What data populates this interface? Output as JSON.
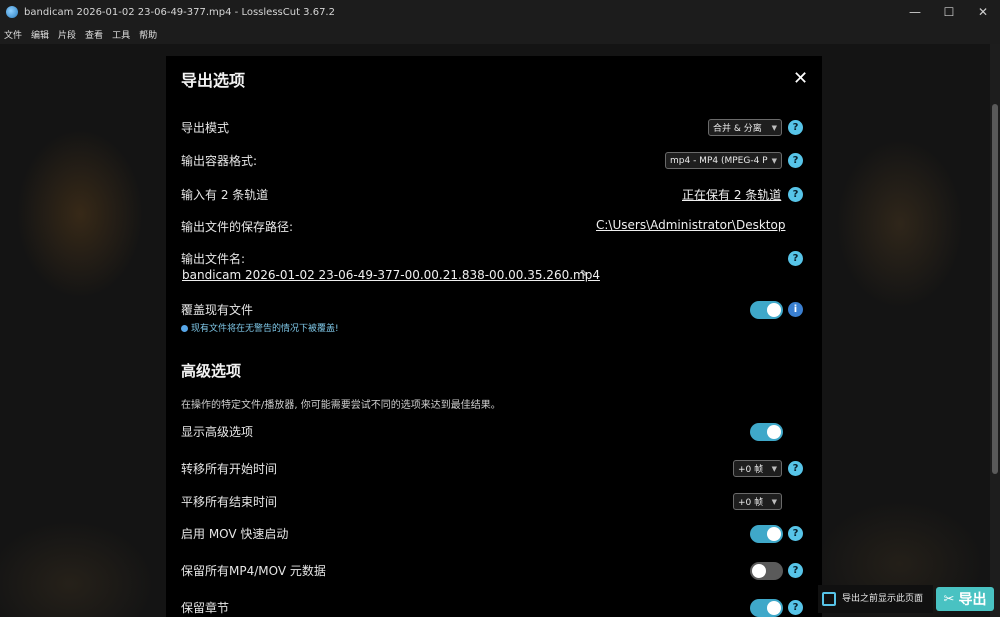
{
  "window": {
    "title": "bandicam 2026-01-02 23-06-49-377.mp4 - LosslessCut 3.67.2",
    "minimize": "—",
    "maximize": "☐",
    "close": "✕"
  },
  "menu": [
    "文件",
    "编辑",
    "片段",
    "查看",
    "工具",
    "帮助"
  ],
  "dialog": {
    "title": "导出选项",
    "close": "✕",
    "rows": {
      "export_mode": {
        "label": "导出模式",
        "value": "合并 & 分离"
      },
      "container_format": {
        "label": "输出容器格式:",
        "value": "mp4 - MP4 (MPEG-4 P"
      },
      "tracks": {
        "label": "输入有 2 条轨道",
        "value": "正在保有 2 条轨道"
      },
      "save_path": {
        "label": "输出文件的保存路径:",
        "value": "C:\\Users\\Administrator\\Desktop"
      },
      "filename": {
        "label": "输出文件名:",
        "value": "bandicam 2026-01-02 23-06-49-377-00.00.21.838-00.00.35.260.mp4"
      },
      "overwrite": {
        "label": "覆盖现有文件",
        "note": "现有文件将在无警告的情况下被覆盖!",
        "enabled": true
      }
    },
    "advanced": {
      "title": "高级选项",
      "description": "在操作的特定文件/播放器, 你可能需要尝试不同的选项来达到最佳结果。",
      "show_advanced": {
        "label": "显示高级选项",
        "enabled": true
      },
      "shift_start": {
        "label": "转移所有开始时间",
        "value": "+0 帧"
      },
      "shift_end": {
        "label": "平移所有结束时间",
        "value": "+0 帧"
      },
      "mov_faststart": {
        "label": "启用 MOV 快速启动",
        "enabled": true
      },
      "preserve_metadata": {
        "label": "保留所有MP4/MOV 元数据",
        "enabled": false
      },
      "preserve_chapters": {
        "label": "保留章节",
        "enabled": true
      }
    }
  },
  "footer": {
    "hint": "导出之前显示此页面",
    "export_label": "导出"
  },
  "icons": {
    "help": "?",
    "info": "i",
    "edit": "✎",
    "caret": "▼",
    "scissors": "✂"
  },
  "colors": {
    "accent": "#49c2c2",
    "toggle_on": "#3fa8c9",
    "help_bg": "#57c4e8"
  }
}
